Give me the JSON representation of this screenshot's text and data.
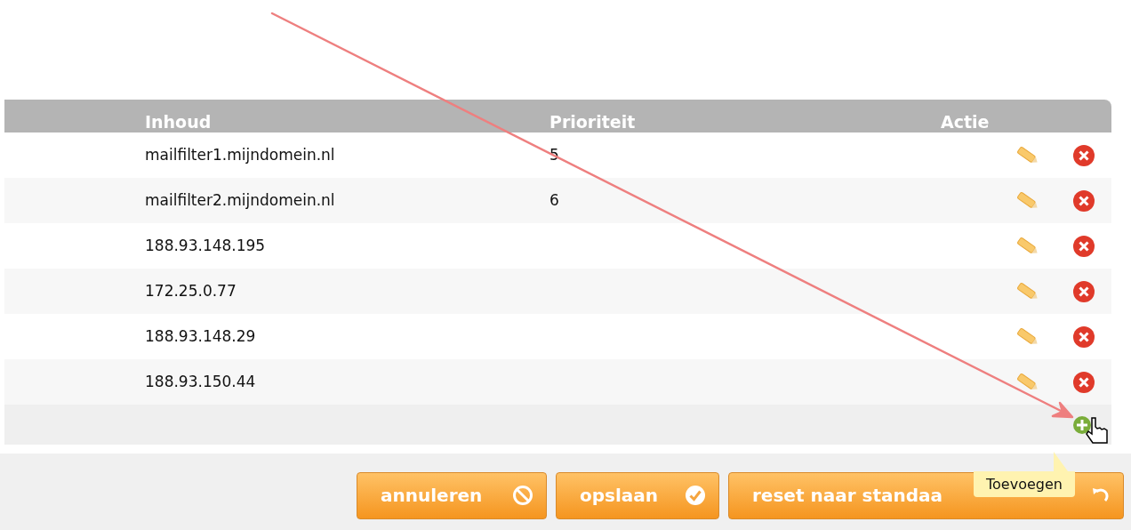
{
  "table": {
    "columns": [
      "Inhoud",
      "Prioriteit",
      "Actie"
    ],
    "rows": [
      {
        "inhoud": "mailfilter1.mijndomein.nl",
        "prioriteit": "5"
      },
      {
        "inhoud": "mailfilter2.mijndomein.nl",
        "prioriteit": "6"
      },
      {
        "inhoud": "188.93.148.195"
      },
      {
        "inhoud": "172.25.0.77"
      },
      {
        "inhoud": "188.93.148.29"
      },
      {
        "inhoud": "188.93.150.44"
      }
    ]
  },
  "tooltip": "Toevoegen",
  "buttons": [
    {
      "label": "annuleren",
      "kind": "cancel"
    },
    {
      "label": "opslaan",
      "kind": "save"
    },
    {
      "label": "reset naar standaa",
      "kind": "reset"
    }
  ]
}
